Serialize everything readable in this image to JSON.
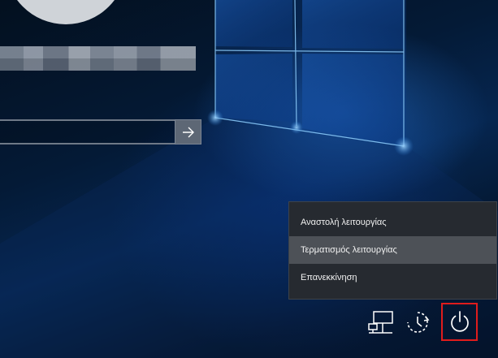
{
  "login": {
    "username_blurred": true
  },
  "password": {
    "submit_icon": "arrow-right-icon"
  },
  "power_menu": {
    "items": [
      {
        "label": "Αναστολή λειτουργίας",
        "selected": false
      },
      {
        "label": "Τερματισμός λειτουργίας",
        "selected": true
      },
      {
        "label": "Επανεκκίνηση",
        "selected": false
      }
    ]
  },
  "tray": {
    "network_icon": "network-icon",
    "ease_of_access_icon": "ease-of-access-icon",
    "power_icon": "power-icon"
  },
  "colors": {
    "menu_bg": "#262a30",
    "menu_selected": "#4d5157",
    "highlight_border": "#e01c1c"
  }
}
